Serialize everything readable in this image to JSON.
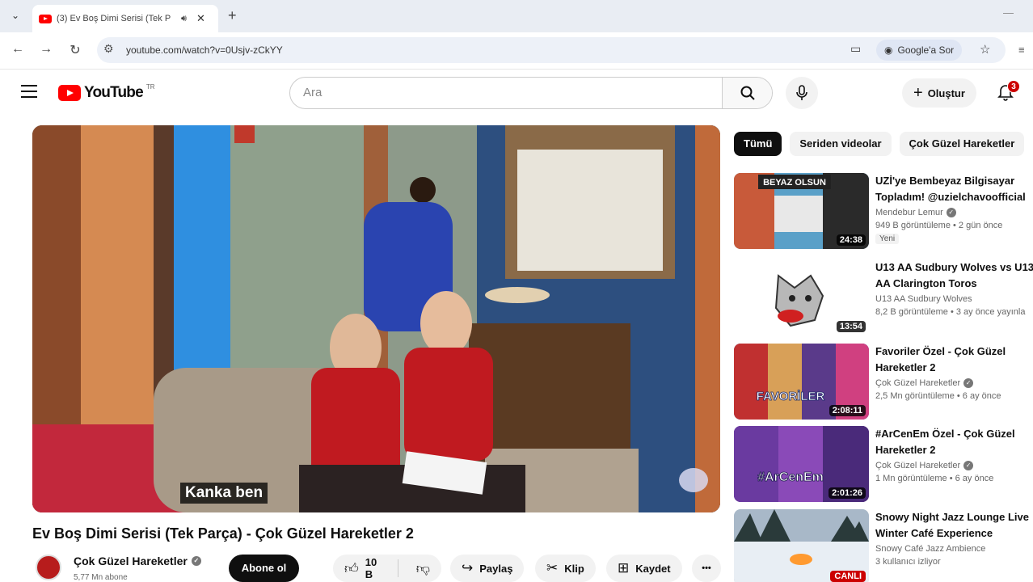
{
  "browser": {
    "tab_title": "(3) Ev Boş Dimi Serisi (Tek P",
    "url": "youtube.com/watch?v=0Usjv-zCkYY",
    "google_ask": "Google'a Sor"
  },
  "header": {
    "logo_text": "YouTube",
    "logo_suffix": "TR",
    "search_placeholder": "Ara",
    "create_label": "Oluştur",
    "notification_count": "3"
  },
  "player": {
    "subtitle": "Kanka ben"
  },
  "video": {
    "title": "Ev Boş Dimi Serisi (Tek Parça) - Çok Güzel Hareketler 2",
    "channel": "Çok Güzel Hareketler",
    "subscribers": "5,77 Mn abone",
    "subscribe_label": "Abone ol",
    "likes": "10 B",
    "share_label": "Paylaş",
    "clip_label": "Klip",
    "save_label": "Kaydet",
    "more_label": "•••"
  },
  "chips": [
    "Tümü",
    "Seriden videolar",
    "Çok Güzel Hareketler"
  ],
  "recommendations": [
    {
      "title1": "UZİ'ye Bembeyaz Bilgisayar",
      "title2": "Topladım! @uzielchavoofficial",
      "channel": "Mendebur Lemur",
      "verified": true,
      "stats": "949 B görüntüleme • 2 gün önce",
      "badge": "Yeni",
      "duration": "24:38",
      "thumb_text": "BEYAZ OLSUN"
    },
    {
      "title1": "U13 AA Sudbury Wolves  vs U13",
      "title2": "AA Clarington Toros",
      "channel": "U13 AA Sudbury Wolves",
      "verified": false,
      "stats": "8,2 B görüntüleme • 3 ay önce yayınla",
      "badge": "",
      "duration": "13:54",
      "thumb_text": ""
    },
    {
      "title1": "Favoriler Özel - Çok Güzel",
      "title2": "Hareketler 2",
      "channel": "Çok Güzel Hareketler",
      "verified": true,
      "stats": "2,5 Mn görüntüleme • 6 ay önce",
      "badge": "",
      "duration": "2:08:11",
      "thumb_text": "FAVORİLER"
    },
    {
      "title1": "#ArCenEm Özel - Çok Güzel",
      "title2": "Hareketler 2",
      "channel": "Çok Güzel Hareketler",
      "verified": true,
      "stats": "1 Mn görüntüleme • 6 ay önce",
      "badge": "",
      "duration": "2:01:26",
      "thumb_text": "#ArCenEm"
    },
    {
      "title1": "Snowy Night Jazz Lounge Live",
      "title2": "Winter Café Experience",
      "channel": "Snowy Café Jazz Ambience",
      "verified": false,
      "stats": "3 kullanıcı izliyor",
      "badge": "",
      "duration": "CANLI",
      "thumb_text": ""
    }
  ],
  "colors": {
    "youtube_red": "#ff0000",
    "chip_active": "#0f0f0f",
    "chip_bg": "#f2f2f2"
  }
}
